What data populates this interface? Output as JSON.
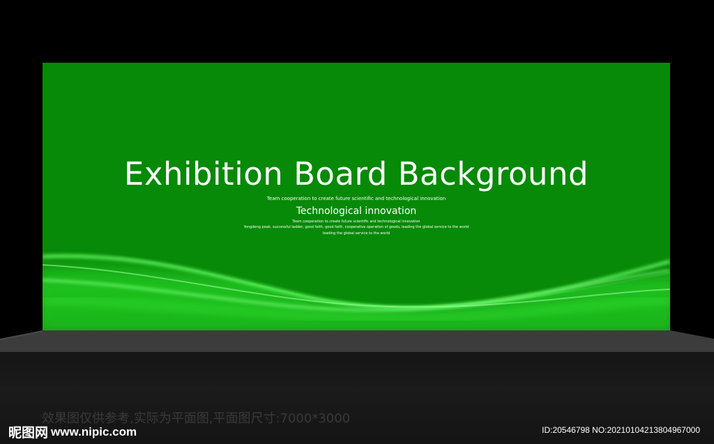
{
  "board": {
    "title": "Exhibition Board Background",
    "subtitle_top": "Team cooperation to create future scientific and technological innovation",
    "subtitle_main": "Technological innovation",
    "line_1": "Team cooperation to create future scientific and technological innovation",
    "line_2": "Yongdeng peak, successful ladder, good faith, good faith, cooperative operation of goods, leading the global service to the world",
    "line_3": "leading the global service to the world"
  },
  "caption": "效果图仅供参考,实际为平面图,平面图尺寸:7000*3000",
  "watermark": {
    "logo_text": "昵图网",
    "url": "www.nipic.com",
    "meta": "ID:20546798 NO:20210104213804967000"
  },
  "colors": {
    "board": "#078a07",
    "wave": "#39ff39",
    "background": "#000000",
    "floor": "#3a3a3a"
  }
}
